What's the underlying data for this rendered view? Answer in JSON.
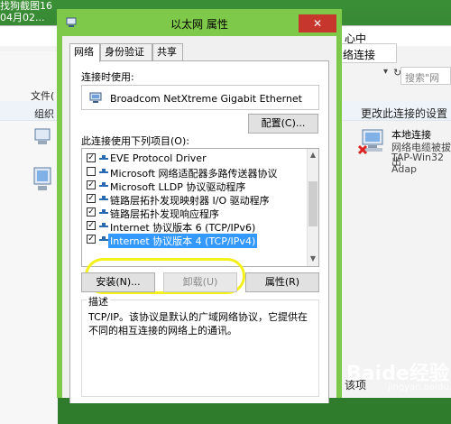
{
  "desktop": {
    "label_line1": "找狗截图16",
    "label_line2": "04月02..."
  },
  "background_window": {
    "title_fragment": "心中",
    "address_fragment": "络连接",
    "search_placeholder": "搜索\"网",
    "left_fragments": [
      "文件(",
      "组织"
    ],
    "cmd_change_settings": "更改此连接的设置",
    "connection": {
      "name": "本地连接",
      "status": "网络电缆被拔出",
      "adapter": "TAP-Win32 Adap"
    },
    "bottom_fragment": "该项"
  },
  "dialog": {
    "title": "以太网 属性",
    "close_glyph": "✕",
    "tabs": [
      "网络",
      "身份验证",
      "共享"
    ],
    "connect_using_label": "连接时使用:",
    "adapter_name": "Broadcom NetXtreme Gigabit Ethernet",
    "configure_button": "配置(C)...",
    "items_label": "此连接使用下列项目(O):",
    "items": [
      {
        "label": "EVE Protocol Driver",
        "checked": true
      },
      {
        "label": "Microsoft 网络适配器多路传送器协议",
        "checked": false
      },
      {
        "label": "Microsoft LLDP 协议驱动程序",
        "checked": true
      },
      {
        "label": "链路层拓扑发现映射器 I/O 驱动程序",
        "checked": true
      },
      {
        "label": "链路层拓扑发现响应程序",
        "checked": true
      },
      {
        "label": "Internet 协议版本 6 (TCP/IPv6)",
        "checked": true
      },
      {
        "label": "Internet 协议版本 4 (TCP/IPv4)",
        "checked": true
      }
    ],
    "install_button": "安装(N)...",
    "uninstall_button": "卸载(U)",
    "properties_button": "属性(R)",
    "description_title": "描述",
    "description_text": "TCP/IP。该协议是默认的广域网络协议，它提供在不同的相互连接的网络上的通讯。"
  },
  "watermark": {
    "text": "Baide经验",
    "sub": "jingyan.baidu.com"
  },
  "colors": {
    "dialog_frame": "#7fc94a",
    "selection": "#3399ff",
    "highlight_ring": "#f4f01a",
    "close_button": "#c7362c"
  }
}
